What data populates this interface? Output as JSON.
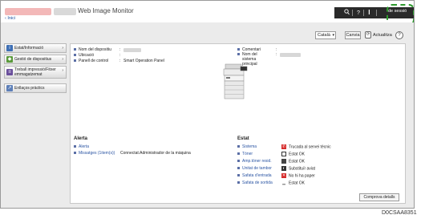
{
  "header": {
    "app_title": "Web Image Monitor",
    "home_link": "‹ Inici",
    "login_link": "de sessió"
  },
  "toolbar": {
    "language": "Català",
    "change_label": "Canvia",
    "refresh_label": "Actualitza",
    "help_symbol": "?"
  },
  "sidebar": {
    "items": [
      {
        "label": "Estat/Informació",
        "icon": "info-icon"
      },
      {
        "label": "Gestió de dispositius",
        "icon": "device-management-icon"
      },
      {
        "label": "Treball impressió/Fitxer emmagatzemat",
        "icon": "print-job-icon"
      },
      {
        "label": "Enllaços pràctics",
        "icon": "links-icon"
      }
    ]
  },
  "device_info": {
    "name_label": "Nom del dispositiu",
    "location_label": "Ubicació",
    "control_panel_label": "Panell de control",
    "control_panel_value": "Smart Operation Panel",
    "comment_label": "Comentari",
    "host_label": "Nom del sistema principal",
    "colon": ":"
  },
  "alert": {
    "title": "Alerta",
    "items": [
      {
        "label": "Alerta",
        "value": ""
      },
      {
        "label": "Missatges (1item(s))",
        "value": "Connectat:Administrador de la màquina"
      }
    ]
  },
  "status": {
    "title": "Estat",
    "items": [
      {
        "label": "Sistema",
        "value": "Trucada al servei tècnic",
        "icon": "service-call-icon",
        "color": "#d62b2b"
      },
      {
        "label": "Tòner",
        "value": "Estat OK",
        "icon": "toner-icon",
        "color": "#222222"
      },
      {
        "label": "Amp.tòner resid.",
        "value": "Estat OK",
        "icon": "waste-toner-icon",
        "color": "#222222"
      },
      {
        "label": "Unitat de tambor",
        "value": "Substituïr aviat",
        "icon": "drum-unit-icon",
        "color": "#222222"
      },
      {
        "label": "Safata d'entrada",
        "value": "No hi ha paper",
        "icon": "no-paper-icon",
        "color": "#d62b2b"
      },
      {
        "label": "Safata de sortida",
        "value": "Estat OK",
        "icon": "output-tray-icon",
        "color": "#222222"
      }
    ],
    "detail_button": "Comprova detalls"
  },
  "caption": "D0CSAA8351",
  "colors": {
    "highlight_dashed": "#2f9a2f",
    "link": "#2b55a3",
    "error_red": "#d62b2b"
  }
}
